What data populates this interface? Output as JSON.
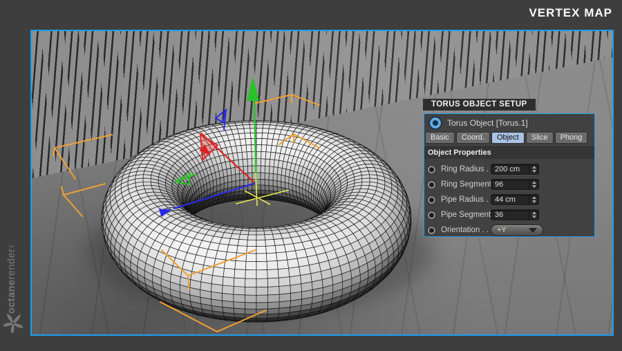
{
  "header": {
    "title": "VERTEX MAP"
  },
  "brand": {
    "bold": "octane",
    "light": "render",
    "tm": "™"
  },
  "theme": {
    "accent_blue": "#1e9eef",
    "tab_active_bg": "#a9c3e4",
    "selection_orange": "#f0a035",
    "axis_x_red": "#dd2222",
    "axis_y_green": "#28c228",
    "axis_z_blue": "#2828e8",
    "gizmo_yellow": "#e6e650"
  },
  "panel": {
    "title": "TORUS OBJECT SETUP",
    "object": {
      "label": "Torus Object [Torus.1]"
    },
    "tabs": [
      {
        "label": "Basic",
        "active": false
      },
      {
        "label": "Coord.",
        "active": false
      },
      {
        "label": "Object",
        "active": true
      },
      {
        "label": "Slice",
        "active": false
      },
      {
        "label": "Phong",
        "active": false
      }
    ],
    "section_title": "Object Properties",
    "properties": [
      {
        "label": "Ring Radius . . .",
        "value": "200 cm",
        "control": "stepper"
      },
      {
        "label": "Ring Segments",
        "value": "96",
        "control": "stepper"
      },
      {
        "label": "Pipe Radius . . .",
        "value": "44 cm",
        "control": "stepper"
      },
      {
        "label": "Pipe Segments",
        "value": "36",
        "control": "stepper"
      },
      {
        "label": "Orientation . . .",
        "value": "+Y",
        "control": "dropdown"
      }
    ]
  },
  "scene": {
    "torus": {
      "ring_radius_cm": 200,
      "ring_segments": 96,
      "pipe_radius_cm": 44,
      "pipe_segments": 36,
      "orientation": "+Y"
    }
  }
}
